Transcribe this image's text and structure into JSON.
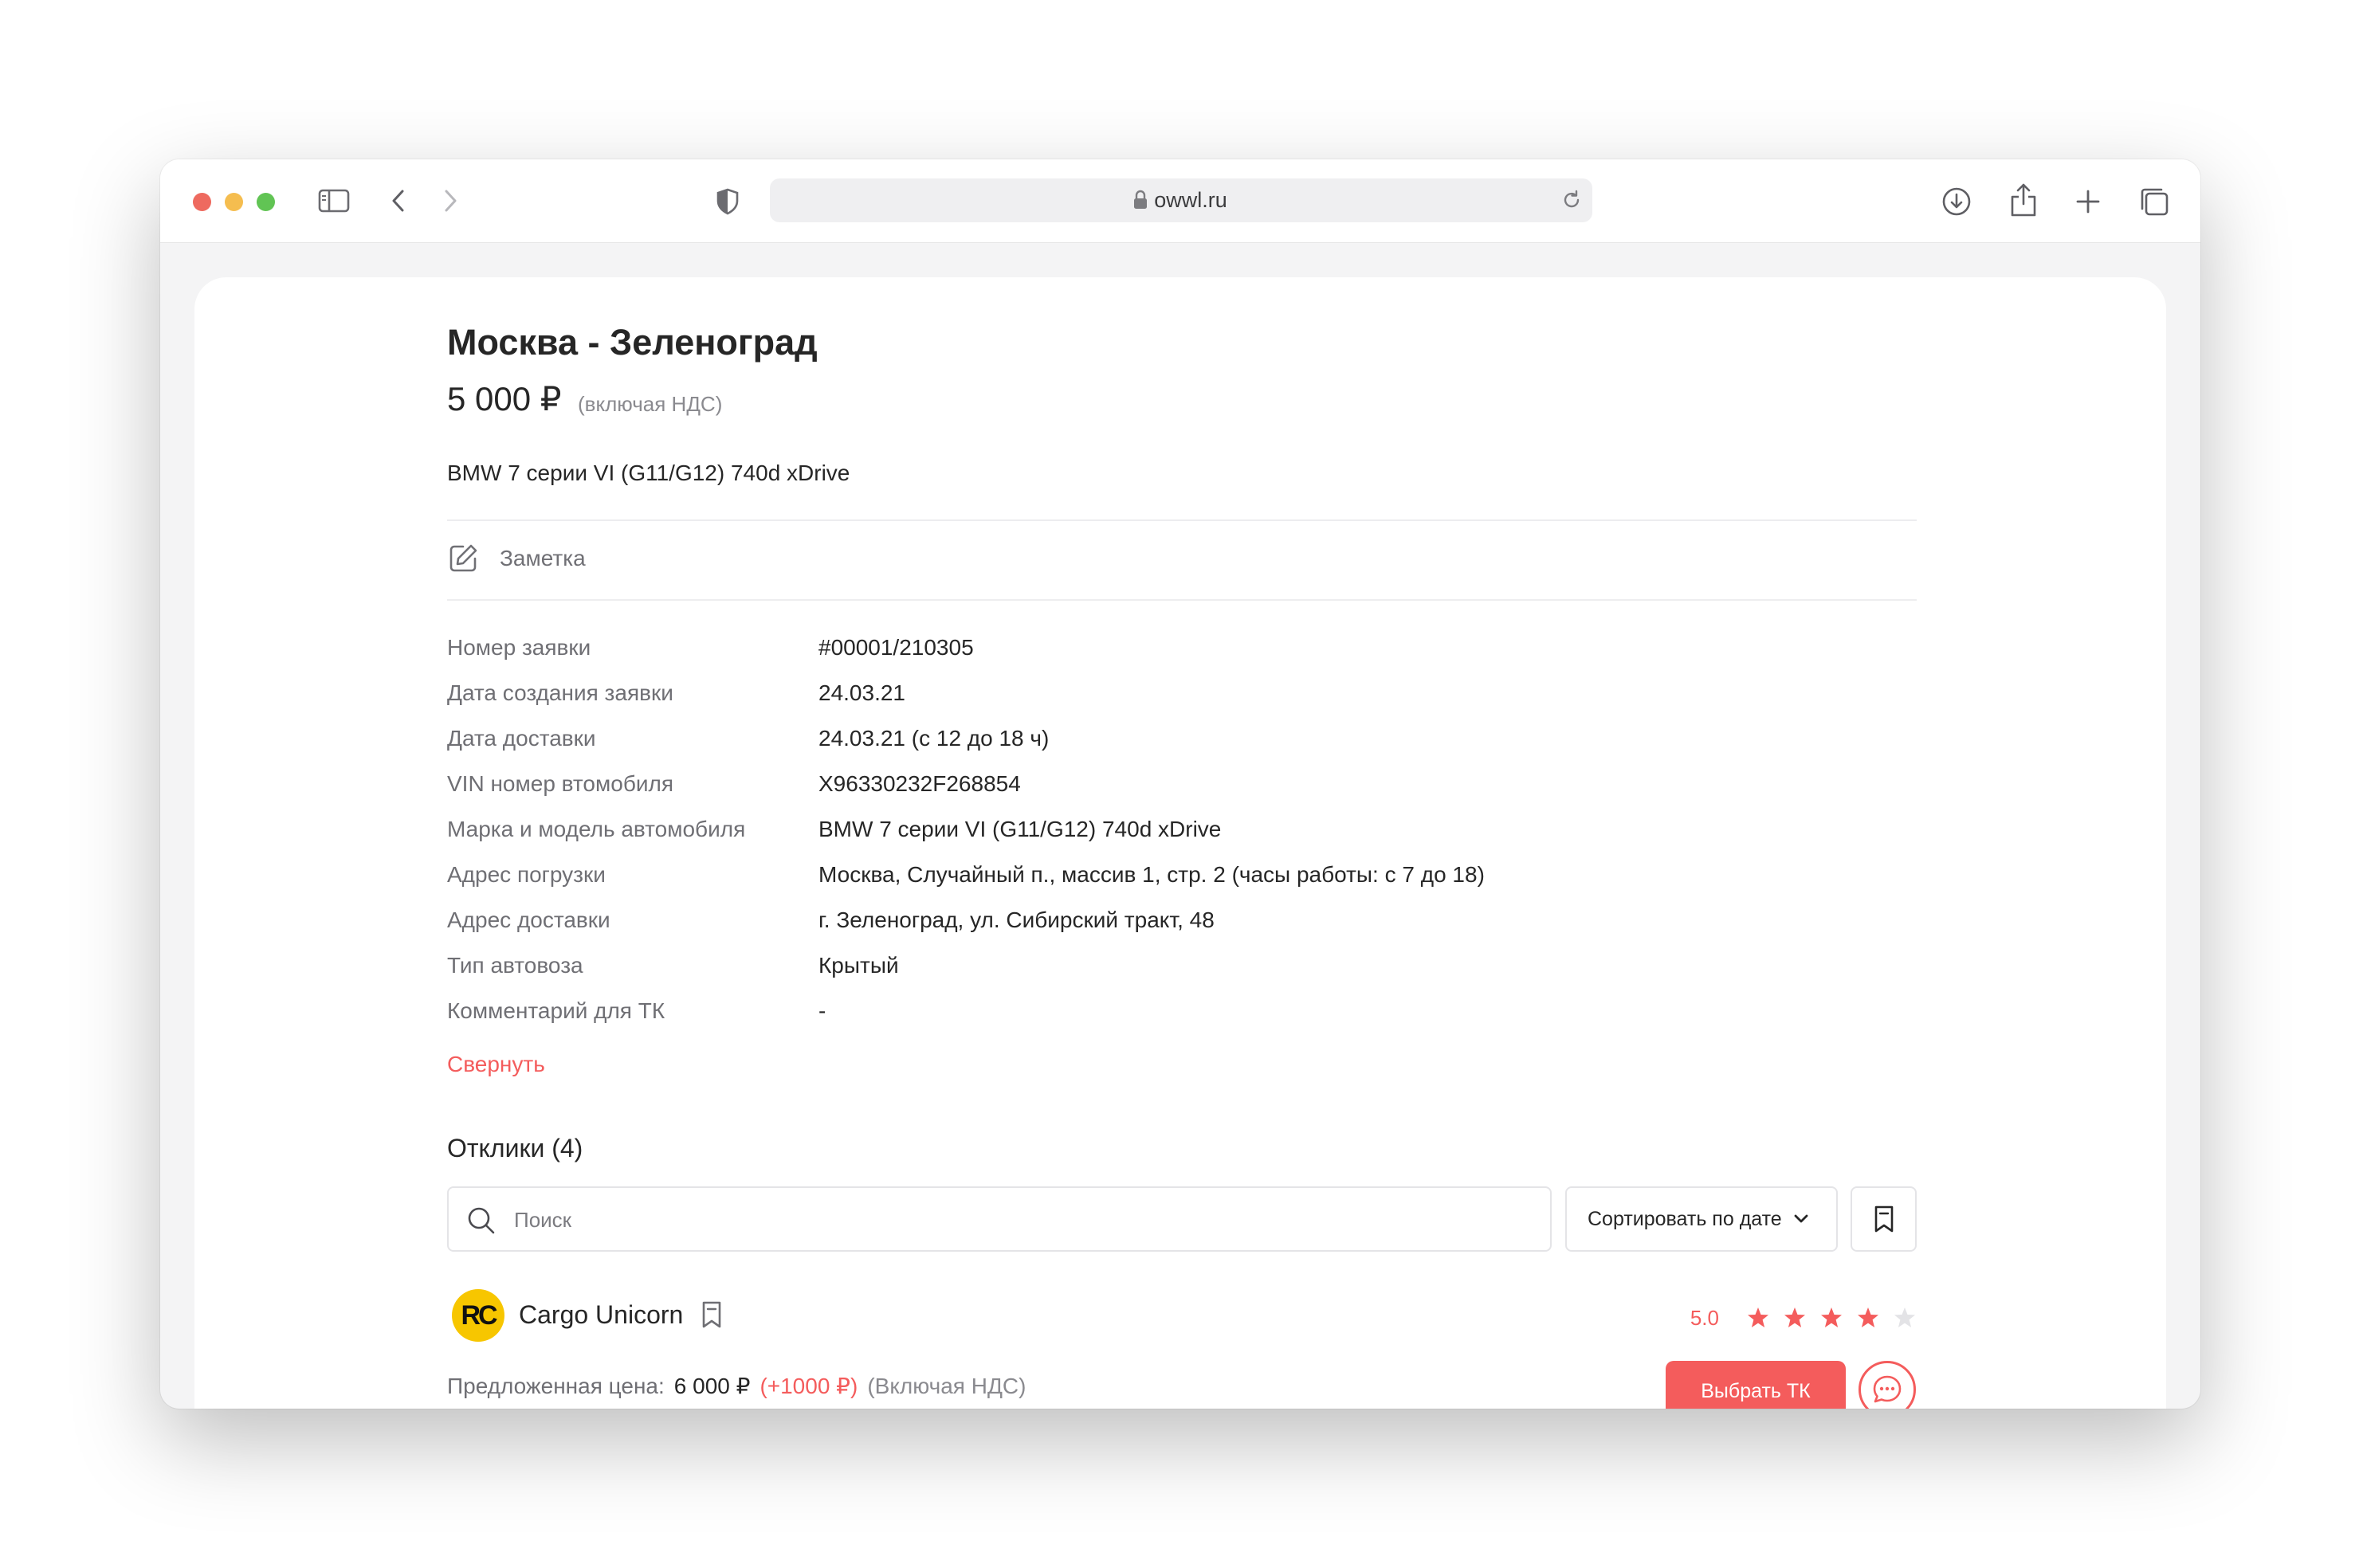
{
  "browser": {
    "url": "owwl.ru",
    "icons": [
      "sidebar-icon",
      "back-icon",
      "forward-icon",
      "privacy-shield-icon",
      "lock-icon",
      "reload-icon",
      "download-icon",
      "share-icon",
      "new-tab-icon",
      "tab-overview-icon"
    ]
  },
  "order": {
    "title": "Москва - Зеленоград",
    "price": "5 000 ₽",
    "price_note": "(включая НДС)",
    "model": "BMW 7 серии VI (G11/G12) 740d xDrive",
    "note_label": "Заметка",
    "details": [
      {
        "label": "Номер заявки",
        "value": "#00001/210305"
      },
      {
        "label": "Дата создания заявки",
        "value": "24.03.21"
      },
      {
        "label": "Дата доставки",
        "value": "24.03.21 (с 12 до 18 ч)"
      },
      {
        "label": "VIN номер втомобиля",
        "value": "X96330232F268854"
      },
      {
        "label": "Марка и модель автомобиля",
        "value": "BMW 7 серии VI (G11/G12) 740d xDrive"
      },
      {
        "label": "Адрес погрузки",
        "value": "Москва, Случайный п., массив 1, стр. 2 (часы работы: с 7 до 18)"
      },
      {
        "label": "Адрес доставки",
        "value": "г. Зеленоград, ул. Сибирский тракт, 48"
      },
      {
        "label": "Тип автовоза",
        "value": "Крытый"
      },
      {
        "label": "Комментарий для ТК",
        "value": "-"
      }
    ],
    "collapse_label": "Свернуть"
  },
  "responses": {
    "title": "Отклики (4)",
    "search_placeholder": "Поиск",
    "sort_label": "Сортировать по дате",
    "items": [
      {
        "logo_text": "RC",
        "name": "Cargo Unicorn",
        "rating": "5.0",
        "stars_filled": 4,
        "stars_total": 5,
        "offer_label": "Предложенная цена:",
        "offer_price": "6 000 ₽",
        "offer_diff": "(+1000 ₽)",
        "offer_vat": "(Включая НДС)",
        "choose_label": "Выбрать ТК"
      }
    ]
  },
  "colors": {
    "accent": "#f45c5c",
    "text": "#262626",
    "muted": "#6f6f74",
    "logo_bg": "#f7c600",
    "star_empty": "#e3e3e6"
  }
}
